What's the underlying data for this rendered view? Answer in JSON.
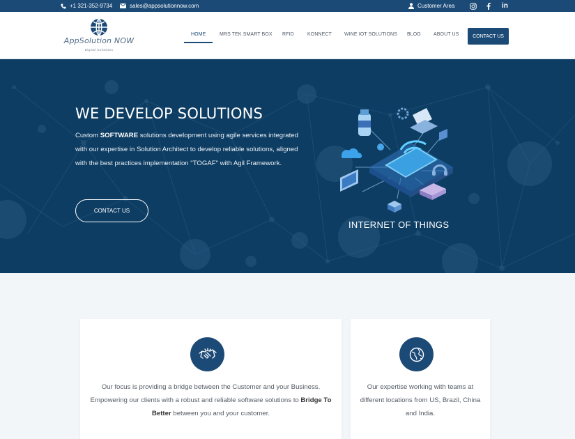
{
  "topbar": {
    "phone": "+1 321-352-9734",
    "email": "sales@appsolutionnow.com",
    "customer_area": "Customer Area",
    "social": [
      "instagram-icon",
      "facebook-icon",
      "linkedin-icon"
    ],
    "linkedin_label": "in"
  },
  "header": {
    "logo_text": "AppSolution NOW",
    "logo_subtext": "Digital Solutions",
    "nav": [
      {
        "label": "HOME",
        "active": true
      },
      {
        "label": "MRS TEK SMART BOX"
      },
      {
        "label": "RFID"
      },
      {
        "label": "KONNECT"
      },
      {
        "label": "WINE IOT SOLUTIONS"
      },
      {
        "label": "BLOG"
      },
      {
        "label": "ABOUT US"
      }
    ],
    "cta": "CONTACT US"
  },
  "hero": {
    "title": "WE DEVELOP SOLUTIONS",
    "text_prefix": "Custom ",
    "text_bold": "SOFTWARE",
    "text_rest": " solutions development using agile services integrated with our expertise in Solution Architect to develop reliable solutions, aligned with the best practices implementation \"TOGAF\" with Agil Framework.",
    "cta": "CONTACT US",
    "illustration_label": "INTERNET OF THINGS"
  },
  "cards": [
    {
      "icon": "handshake-icon",
      "text_prefix": "Our focus is providing a bridge between the Customer and your Business. Empowering our clients with a robust and reliable software solutions to ",
      "text_bold": "Bridge To Better",
      "text_suffix": " between you and your customer."
    },
    {
      "icon": "globe-icon",
      "text": "Our expertise working with teams at different locations from US, Brazil, China and India."
    }
  ],
  "colors": {
    "brand": "#1c4a76",
    "hero_bg": "#0e3d63",
    "page_bg": "#f3f6f9"
  }
}
